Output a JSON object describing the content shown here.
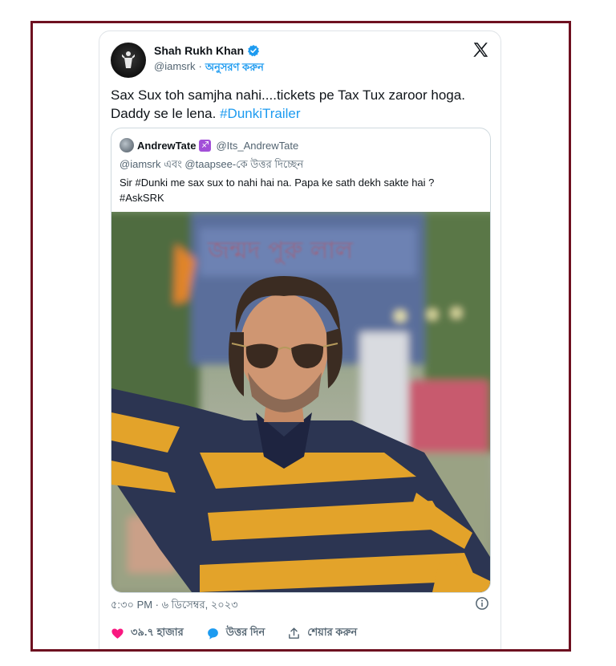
{
  "tweet": {
    "author_name": "Shah Rukh Khan",
    "handle": "@iamsrk",
    "separator": "·",
    "follow_label": "অনুসরণ করুন",
    "text_line1": "Sax Sux toh samjha nahi....tickets pe Tax Tux zaroor hoga.",
    "text_line2_prefix": "Daddy se le lena. ",
    "hashtag": "#DunkiTrailer",
    "timestamp": "৫:৩০ PM · ৬ ডিসেম্বর, ২০২৩"
  },
  "quote": {
    "author_name": "AndrewTate",
    "badge": "♐",
    "handle": "@Its_AndrewTate",
    "reply_context": "@iamsrk এবং @taapsee-কে উত্তর দিচ্ছেন",
    "text_line1": "Sir #Dunki me sax sux to nahi hai na. Papa ke sath dekh sakte hai ?",
    "text_line2": "#AskSRK",
    "image_banner_text": "জন্মদ  পুরু  লাল"
  },
  "actions": {
    "likes_label": "৩৯.৭ হাজার",
    "reply_label": "উত্তর দিন",
    "share_label": "শেয়ার করুন"
  },
  "icons": {
    "verified": "verified-badge-icon",
    "x_logo": "x-logo-icon",
    "info": "info-icon",
    "heart": "heart-icon",
    "reply": "reply-bubble-icon",
    "share": "share-icon"
  },
  "colors": {
    "accent": "#1d9bf0",
    "like": "#f91880",
    "frame_border": "#6e1020",
    "text": "#0f1419",
    "muted": "#536471"
  }
}
